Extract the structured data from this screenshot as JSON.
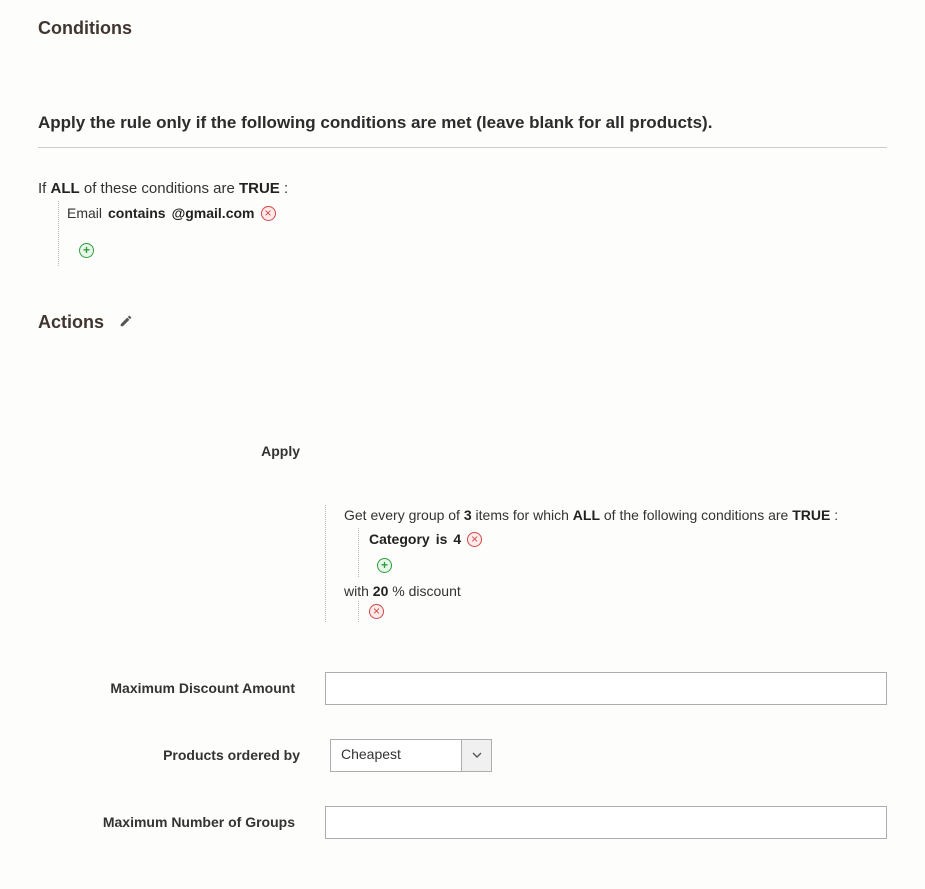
{
  "conditions": {
    "title": "Conditions",
    "desc": "Apply the rule only if the following conditions are met (leave blank for all products).",
    "if_prefix": "If",
    "all": "ALL",
    "if_mid": " of these conditions are",
    "true": "TRUE",
    "colon": " :",
    "rule": {
      "attr": "Email",
      "op": "contains",
      "val": "@gmail.com"
    }
  },
  "actions": {
    "title": "Actions",
    "apply_label": "Apply",
    "group_prefix": "Get every group of",
    "group_n": "3",
    "group_mid": " items for which",
    "all": "ALL",
    "group_tail": " of the following conditions are",
    "true": "TRUE",
    "colon": " :",
    "rule": {
      "attr": "Category",
      "op": "is",
      "val": "4"
    },
    "discount_prefix": "with",
    "discount_val": "20",
    "discount_suffix": " % discount",
    "max_discount_label": "Maximum Discount Amount",
    "max_discount_value": "",
    "ordered_by_label": "Products ordered by",
    "ordered_by_value": "Cheapest",
    "max_groups_label": "Maximum Number of Groups",
    "max_groups_value": ""
  }
}
